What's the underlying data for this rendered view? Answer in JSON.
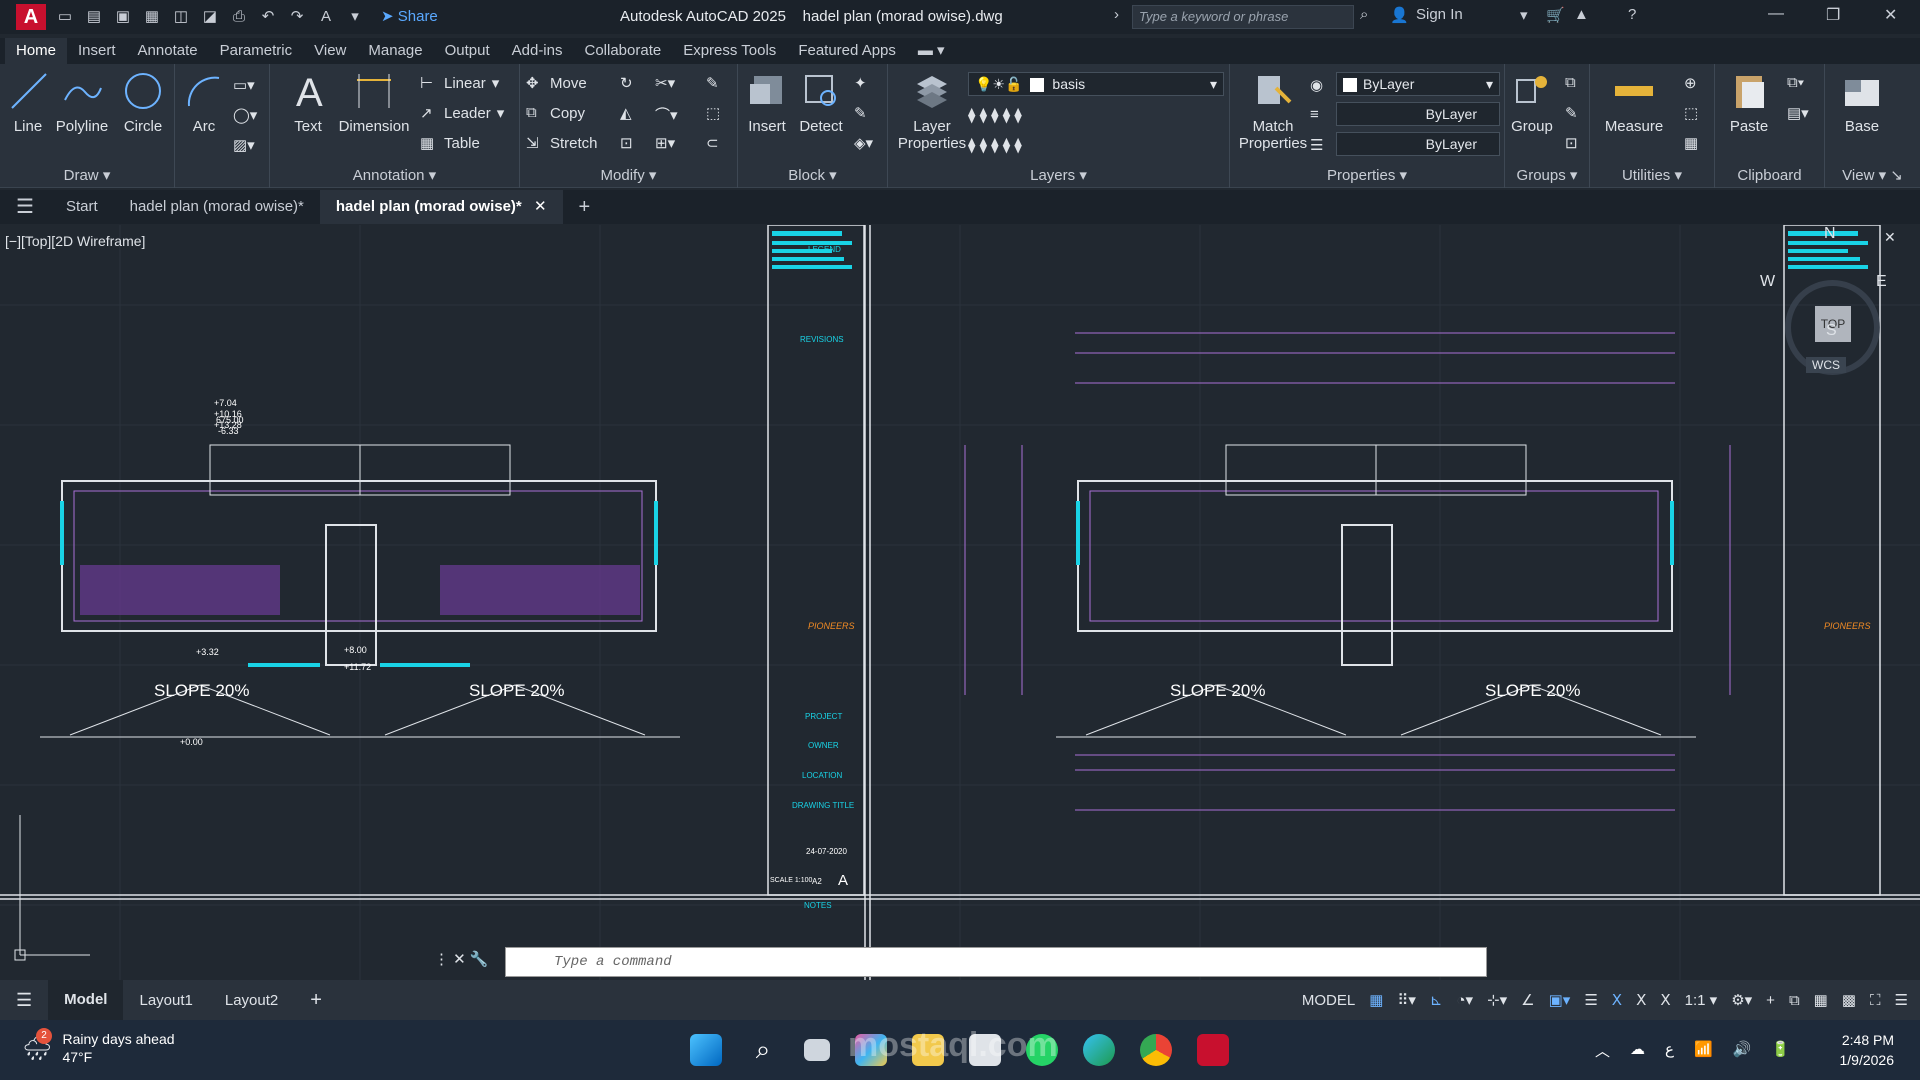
{
  "window": {
    "title": "Autodesk AutoCAD 2025",
    "filename": "hadel plan (morad owise).dwg",
    "search_placeholder": "Type a keyword or phrase",
    "sign_in": "Sign In",
    "share": "Share",
    "logo": "A"
  },
  "ribbon_tabs": [
    "Home",
    "Insert",
    "Annotate",
    "Parametric",
    "View",
    "Manage",
    "Output",
    "Add-ins",
    "Collaborate",
    "Express Tools",
    "Featured Apps"
  ],
  "ribbon": {
    "draw": {
      "title": "Draw",
      "line": "Line",
      "polyline": "Polyline",
      "circle": "Circle",
      "arc": "Arc"
    },
    "annotation": {
      "title": "Annotation",
      "text": "Text",
      "dimension": "Dimension",
      "linear": "Linear",
      "leader": "Leader",
      "table": "Table"
    },
    "modify": {
      "title": "Modify",
      "move": "Move",
      "copy": "Copy",
      "stretch": "Stretch"
    },
    "block": {
      "title": "Block",
      "insert": "Insert",
      "detect": "Detect"
    },
    "layers": {
      "title": "Layers",
      "layer_properties_1": "Layer",
      "layer_properties_2": "Properties",
      "current_layer": "basis"
    },
    "properties": {
      "title": "Properties",
      "match_1": "Match",
      "match_2": "Properties",
      "color": "ByLayer",
      "linetype": "ByLayer",
      "lineweight": "ByLayer"
    },
    "groups": {
      "title": "Groups",
      "group": "Group"
    },
    "utilities": {
      "title": "Utilities",
      "measure": "Measure"
    },
    "clipboard": {
      "title": "Clipboard",
      "paste": "Paste"
    },
    "view": {
      "title": "View",
      "base": "Base"
    }
  },
  "doc_tabs": {
    "start": "Start",
    "tab1": "hadel plan (morad owise)*",
    "tab2": "hadel plan (morad owise)*"
  },
  "viewport": {
    "label": "[−][Top][2D Wireframe]",
    "slope_label": "SLOPE 20%",
    "compass": {
      "n": "N",
      "s": "S",
      "e": "E",
      "w": "W",
      "top": "TOP",
      "wcs": "WCS"
    },
    "levels": [
      "675.00",
      "-6.33",
      "+7.04",
      "+10.16",
      "+13.28",
      "+3.32",
      "+8.00",
      "+11.72",
      "+0.00"
    ],
    "titleblock": {
      "legend": "LEGEND",
      "revisions": "REVISIONS",
      "company": "PIONEERS",
      "project": "PROJECT",
      "owner": "OWNER",
      "location": "LOCATION",
      "drawing_title": "DRAWING TITLE",
      "date": "24-07-2020",
      "scale": "SCALE 1:100",
      "sheet": "A2",
      "rev": "A",
      "notes": "NOTES"
    }
  },
  "command_line": {
    "placeholder": "Type a command"
  },
  "layout_tabs": [
    "Model",
    "Layout1",
    "Layout2"
  ],
  "status_bar": {
    "model": "MODEL",
    "scale": "1:1"
  },
  "taskbar": {
    "weather_title": "Rainy days ahead",
    "weather_temp": "47°F",
    "weather_badge": "2",
    "time": "2:48 PM",
    "date": "1/9/2026",
    "lang": "ع"
  },
  "watermark": "mostaql.com"
}
